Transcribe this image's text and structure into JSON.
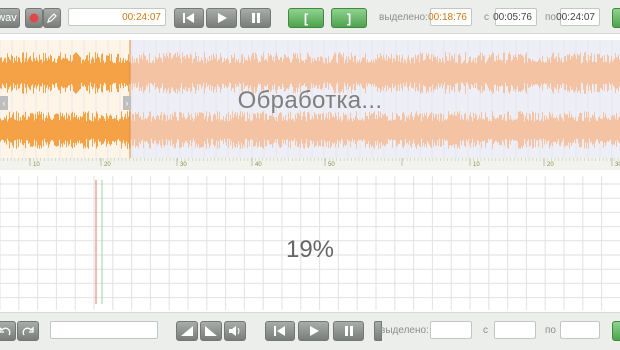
{
  "top_toolbar": {
    "format_label": "wav",
    "time_display": "00:24:07",
    "bracket_open": "[",
    "bracket_close": "]",
    "selected_label": "выделено:",
    "selected_value": "00:18:76",
    "from_label": "с",
    "from_value": "00:05:76",
    "to_label": "по",
    "to_value": "00:24:07"
  },
  "waveform": {
    "processing_text": "Обработка...",
    "played_progress": 0.21,
    "ruler_ticks": [
      "10",
      "20",
      "30",
      "40",
      "50",
      "1m",
      "10",
      "20",
      "30"
    ],
    "played_color": "#f5a246",
    "pending_color": "#f3c3a4"
  },
  "spectrogram": {
    "progress_percent": "19%"
  },
  "bottom_toolbar": {
    "selected_label": "выделено:",
    "from_label": "с",
    "to_label": "по"
  },
  "icons": [
    "record-icon",
    "pen-icon",
    "skip-back-icon",
    "play-icon",
    "pause-icon",
    "undo-icon",
    "redo-icon",
    "fade-in-icon",
    "fade-out-icon",
    "volume-icon"
  ]
}
